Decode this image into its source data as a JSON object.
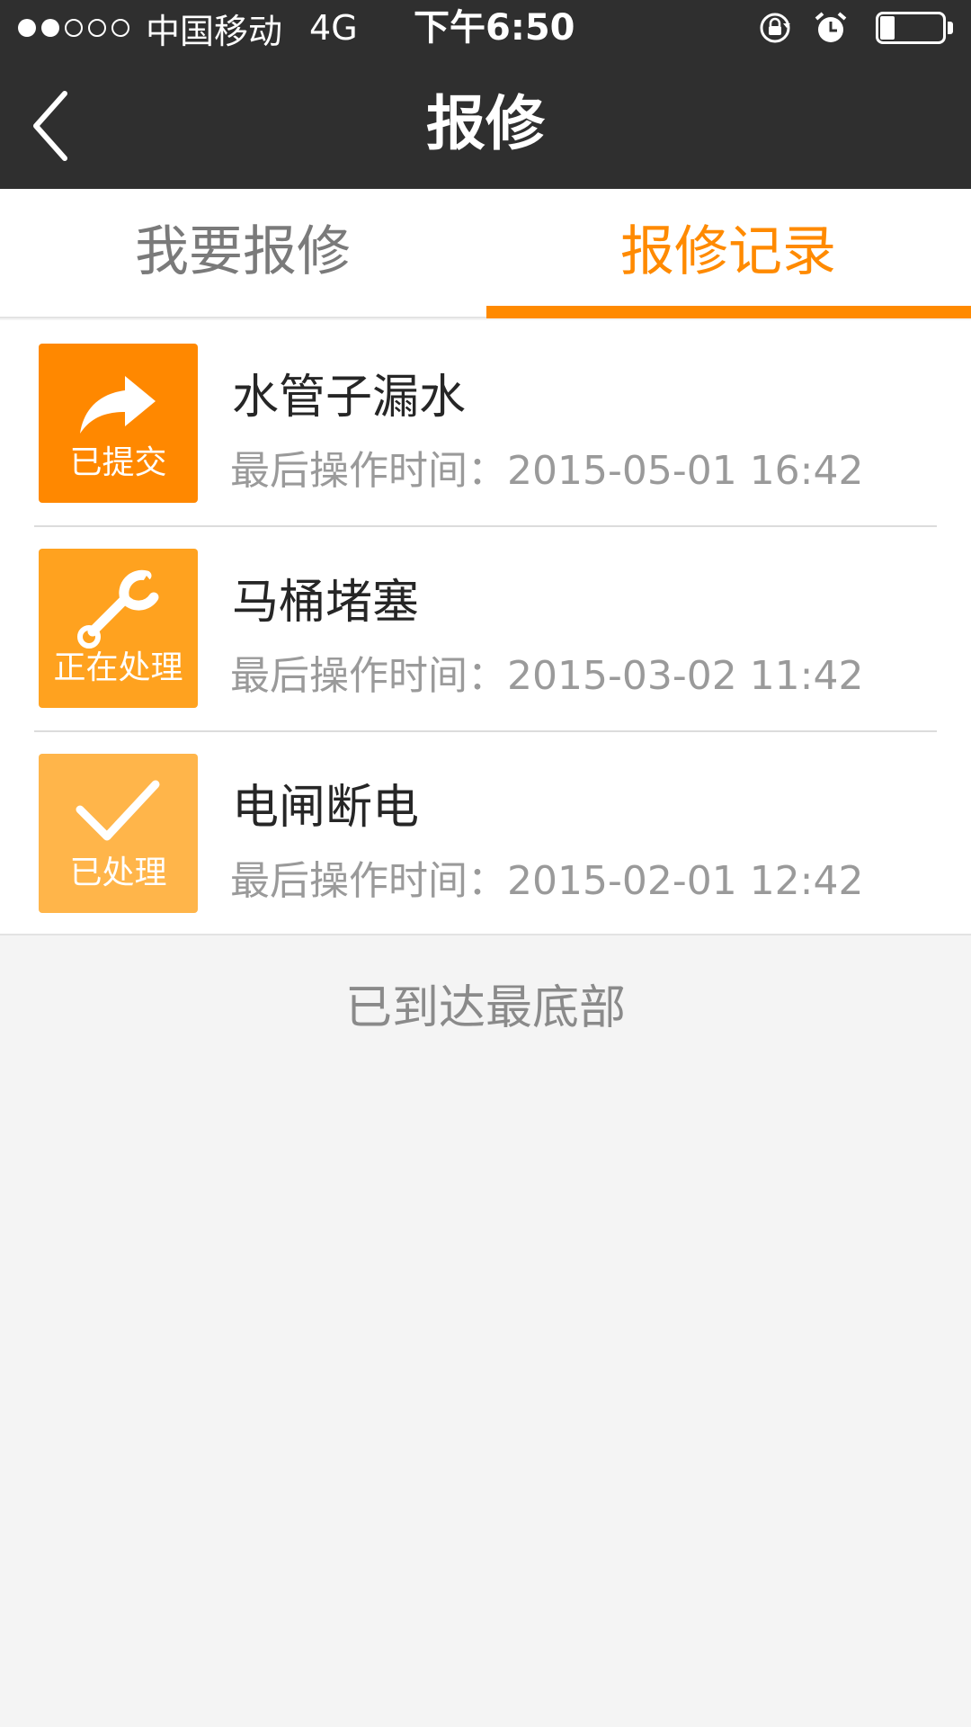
{
  "status_bar": {
    "carrier": "中国移动",
    "network": "4G",
    "time": "下午6:50",
    "signal_bars_filled": 2,
    "signal_bars_total": 5,
    "battery_level": 0.2
  },
  "header": {
    "title": "报修",
    "back_icon": "chevron-left-icon"
  },
  "tabs": [
    {
      "label": "我要报修",
      "active": false
    },
    {
      "label": "报修记录",
      "active": true
    }
  ],
  "records": [
    {
      "status": "已提交",
      "status_icon": "share-arrow-icon",
      "title": "水管子漏水",
      "time": "最后操作时间：2015-05-01  16:42",
      "color": "#ff8800"
    },
    {
      "status": "正在处理",
      "status_icon": "wrench-icon",
      "title": "马桶堵塞",
      "time": "最后操作时间：2015-03-02  11:42",
      "color": "#ffa21f"
    },
    {
      "status": "已处理",
      "status_icon": "checkmark-icon",
      "title": "电闸断电",
      "time": "最后操作时间：2015-02-01  12:42",
      "color": "#ffb54a"
    }
  ],
  "footer": {
    "end_text": "已到达最底部"
  },
  "colors": {
    "accent": "#ff8a00",
    "header_bg": "#2f2f2f",
    "page_bg": "#f4f4f4"
  }
}
